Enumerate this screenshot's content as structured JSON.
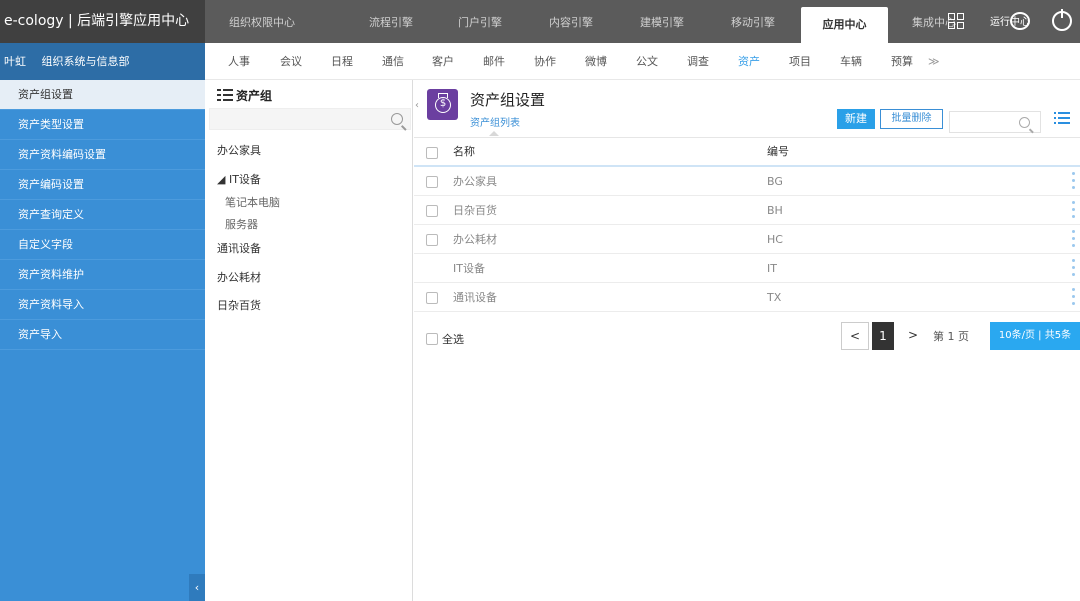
{
  "header": {
    "brand": "e-cology | 后端引擎应用中心",
    "nav": [
      "组织权限中心",
      "流程引擎",
      "门户引擎",
      "内容引擎",
      "建模引擎",
      "移动引擎",
      "应用中心",
      "集成中心"
    ],
    "active_nav": "应用中心",
    "run_center_label": "运行中心"
  },
  "user": {
    "name": "叶虹",
    "dept": "组织系统与信息部"
  },
  "module_tabs": [
    "人事",
    "会议",
    "日程",
    "通信",
    "客户",
    "邮件",
    "协作",
    "微博",
    "公文",
    "调查",
    "资产",
    "项目",
    "车辆",
    "预算"
  ],
  "active_module": "资产",
  "more_glyph": "≫",
  "sidebar": {
    "items": [
      "资产组设置",
      "资产类型设置",
      "资产资料编码设置",
      "资产编码设置",
      "资产查询定义",
      "自定义字段",
      "资产资料维护",
      "资产资料导入",
      "资产导入"
    ],
    "active": "资产组设置",
    "collapse_glyph": "‹"
  },
  "tree": {
    "title": "资产组",
    "nodes": [
      {
        "label": "办公家具"
      },
      {
        "label": "◢ IT设备"
      },
      {
        "label": "笔记本电脑",
        "child": true
      },
      {
        "label": "服务器",
        "child": true
      },
      {
        "label": "通讯设备"
      },
      {
        "label": "办公耗材"
      },
      {
        "label": "日杂百货"
      }
    ]
  },
  "main": {
    "title": "资产组设置",
    "subtitle": "资产组列表",
    "new_label": "新建",
    "batch_delete_label": "批量删除",
    "expand_glyph": "‹"
  },
  "table": {
    "headers": {
      "name": "名称",
      "code": "编号"
    },
    "rows": [
      {
        "name": "办公家具",
        "code": "BG",
        "checkbox": true
      },
      {
        "name": "日杂百货",
        "code": "BH",
        "checkbox": true
      },
      {
        "name": "办公耗材",
        "code": "HC",
        "checkbox": true
      },
      {
        "name": "IT设备",
        "code": "IT",
        "checkbox": false
      },
      {
        "name": "通讯设备",
        "code": "TX",
        "checkbox": true
      }
    ]
  },
  "footer": {
    "select_all": "全选",
    "pager": {
      "prev": "<",
      "current": "1",
      "next": ">",
      "page_text": "第 1 页",
      "page_size": "10条/页 | 共5条"
    }
  },
  "colors": {
    "sidebar": "#3a8fd6",
    "accent": "#2aa0e8",
    "app_icon": "#6b3fa0",
    "topbar": "#5b5b5b"
  }
}
